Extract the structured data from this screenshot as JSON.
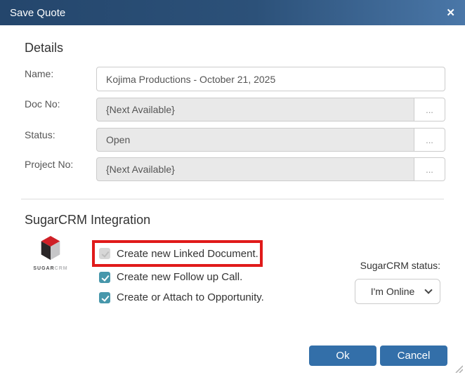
{
  "dialog": {
    "title": "Save Quote",
    "close_glyph": "✕"
  },
  "details": {
    "heading": "Details",
    "fields": [
      {
        "label": "Name:",
        "value": "Kojima Productions - October 21, 2025"
      },
      {
        "label": "Doc No:",
        "value": "{Next Available}",
        "browse": "..."
      },
      {
        "label": "Status:",
        "value": "Open",
        "browse": "..."
      },
      {
        "label": "Project No:",
        "value": "{Next Available}",
        "browse": "..."
      }
    ]
  },
  "sugarcrm": {
    "heading": "SugarCRM Integration",
    "logo": {
      "brand_primary": "SUGAR",
      "brand_secondary": "CRM"
    },
    "checkboxes": [
      {
        "label": "Create new Linked Document.",
        "checked": true,
        "disabled": true,
        "highlighted": true
      },
      {
        "label": "Create new Follow up Call.",
        "checked": true,
        "disabled": false
      },
      {
        "label": "Create or Attach to Opportunity.",
        "checked": true,
        "disabled": false
      }
    ],
    "status_label": "SugarCRM status:",
    "status_value": "I'm Online"
  },
  "footer": {
    "ok_label": "Ok",
    "cancel_label": "Cancel"
  },
  "colors": {
    "header_gradient_start": "#24466c",
    "header_gradient_end": "#4a77a8",
    "checkbox_teal": "#4797ab",
    "highlight_red": "#e01a1a",
    "button_blue": "#336fa9",
    "logo_red": "#cf2027",
    "logo_black": "#2a2627",
    "logo_grey": "#c6c6c8"
  }
}
